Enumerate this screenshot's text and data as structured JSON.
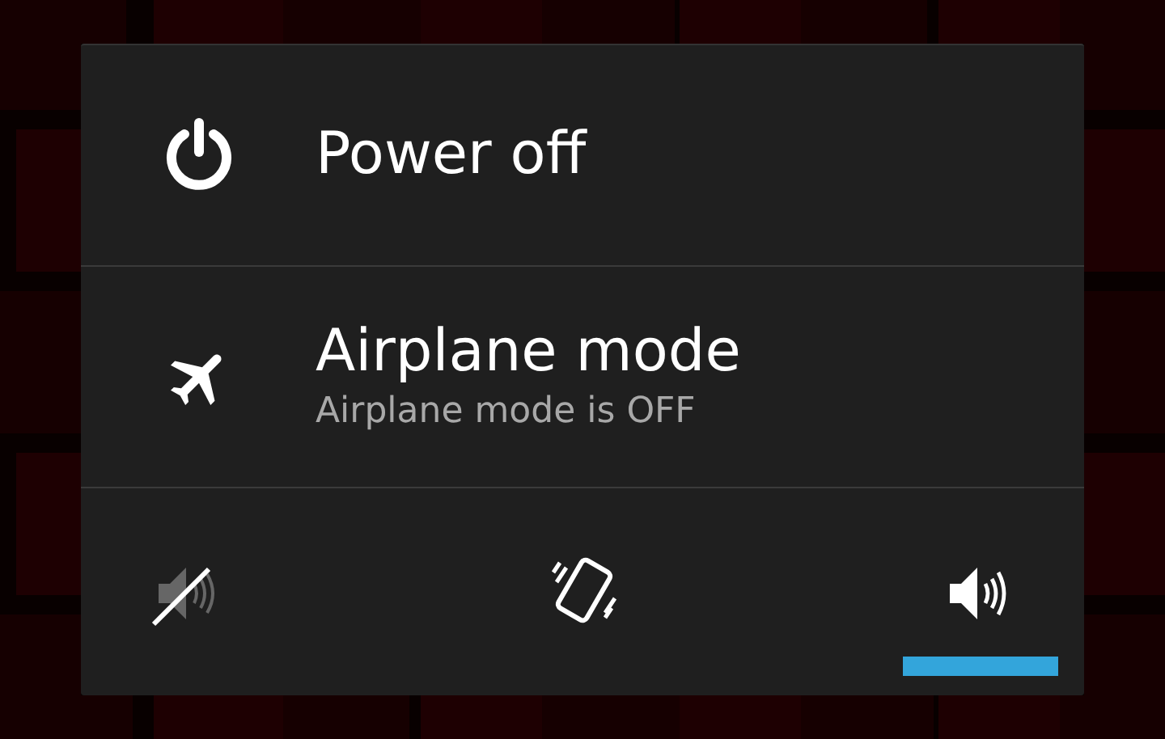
{
  "menu": {
    "items": [
      {
        "kind": "power",
        "title": "Power off"
      },
      {
        "kind": "airplane",
        "title": "Airplane mode",
        "subtitle": "Airplane mode is OFF"
      }
    ],
    "sound_modes": [
      {
        "kind": "silent",
        "selected": false
      },
      {
        "kind": "vibrate",
        "selected": false
      },
      {
        "kind": "sound",
        "selected": true
      }
    ]
  }
}
